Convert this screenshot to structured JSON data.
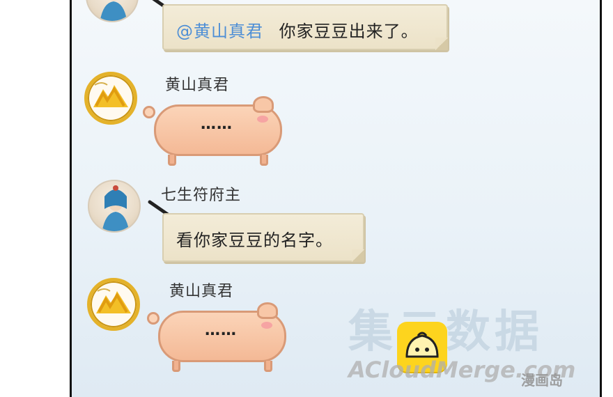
{
  "messages": [
    {
      "sender": "",
      "mention": "@黄山真君",
      "text": "你家豆豆出来了。"
    },
    {
      "sender": "黄山真君",
      "text": "……"
    },
    {
      "sender": "七生符府主",
      "text": "看你家豆豆的名字。"
    },
    {
      "sender": "黄山真君",
      "text": "……"
    }
  ],
  "watermark": {
    "main": "集云数据",
    "sub": "ACloudMerge.com",
    "tag": "漫画岛"
  },
  "icons": [
    "goddess-avatar-icon",
    "mountain-avatar-icon",
    "quill-pen-icon",
    "bun-logo-icon"
  ],
  "colors": {
    "mention": "#4d8ed6",
    "avatar_ring": "#e4b22a",
    "scroll_bg": "#f3ecd8",
    "pig_fill": "#fbd4b8",
    "pig_stroke": "#d99a77",
    "bun_logo": "#fdd41e"
  }
}
